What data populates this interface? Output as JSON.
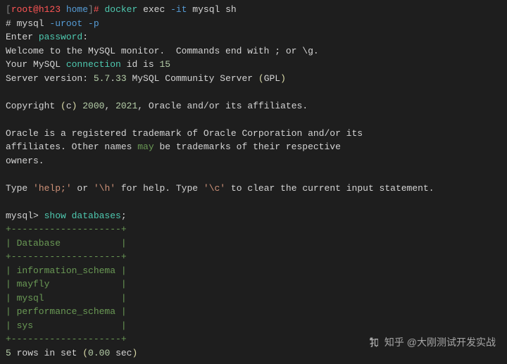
{
  "prompt1": {
    "bracket_open": "[",
    "user_host": "root@h123 ",
    "path": "home",
    "bracket_close": "]",
    "hash": "# ",
    "cmd_docker": "docker",
    "cmd_exec": " exec ",
    "flag_it": "-it",
    "cmd_rest": " mysql sh"
  },
  "line2": {
    "hash": "# mysql ",
    "flag1": "-uroot",
    "space": " ",
    "flag2": "-p"
  },
  "line3": {
    "a": "Enter ",
    "b": "password",
    "c": ":"
  },
  "line4": "Welcome to the MySQL monitor.  Commands end with ; or \\g.",
  "line5": {
    "a": "Your MySQL ",
    "b": "connection",
    "c": " id is ",
    "d": "15"
  },
  "line6": {
    "a": "Server version",
    "b": ": ",
    "c": "5.7",
    "d": ".",
    "e": "33",
    "f": " MySQL Community Server ",
    "g": "(",
    "h": "GPL",
    "i": ")"
  },
  "line7": {
    "a": "Copyright ",
    "b": "(",
    "c": "c",
    "d": ") ",
    "e": "2000",
    "f": ", ",
    "g": "2021",
    "h": ", Oracle and/or its affiliates."
  },
  "line8": "Oracle is a registered trademark of Oracle Corporation and/or its",
  "line9": {
    "a": "affiliates. Other names ",
    "b": "may",
    "c": " be trademarks of their respective"
  },
  "line10": "owners.",
  "line11": {
    "a": "Type ",
    "b": "'help;'",
    "c": " or ",
    "d": "'\\h'",
    "e": " for help. Type ",
    "f": "'\\c'",
    "g": " to clear the current input statement."
  },
  "line12": {
    "a": "mysql> ",
    "b": "show databases",
    "c": ";"
  },
  "table": {
    "border": "+--------------------+",
    "header": "| Database           |",
    "rows": [
      "| information_schema |",
      "| mayfly             |",
      "| mysql              |",
      "| performance_schema |",
      "| sys                |"
    ]
  },
  "line_result": {
    "a": "5",
    "b": " rows in set ",
    "c": "(",
    "d": "0.00",
    "e": " sec",
    "f": ")"
  },
  "watermark": "知乎 @大刚测试开发实战"
}
